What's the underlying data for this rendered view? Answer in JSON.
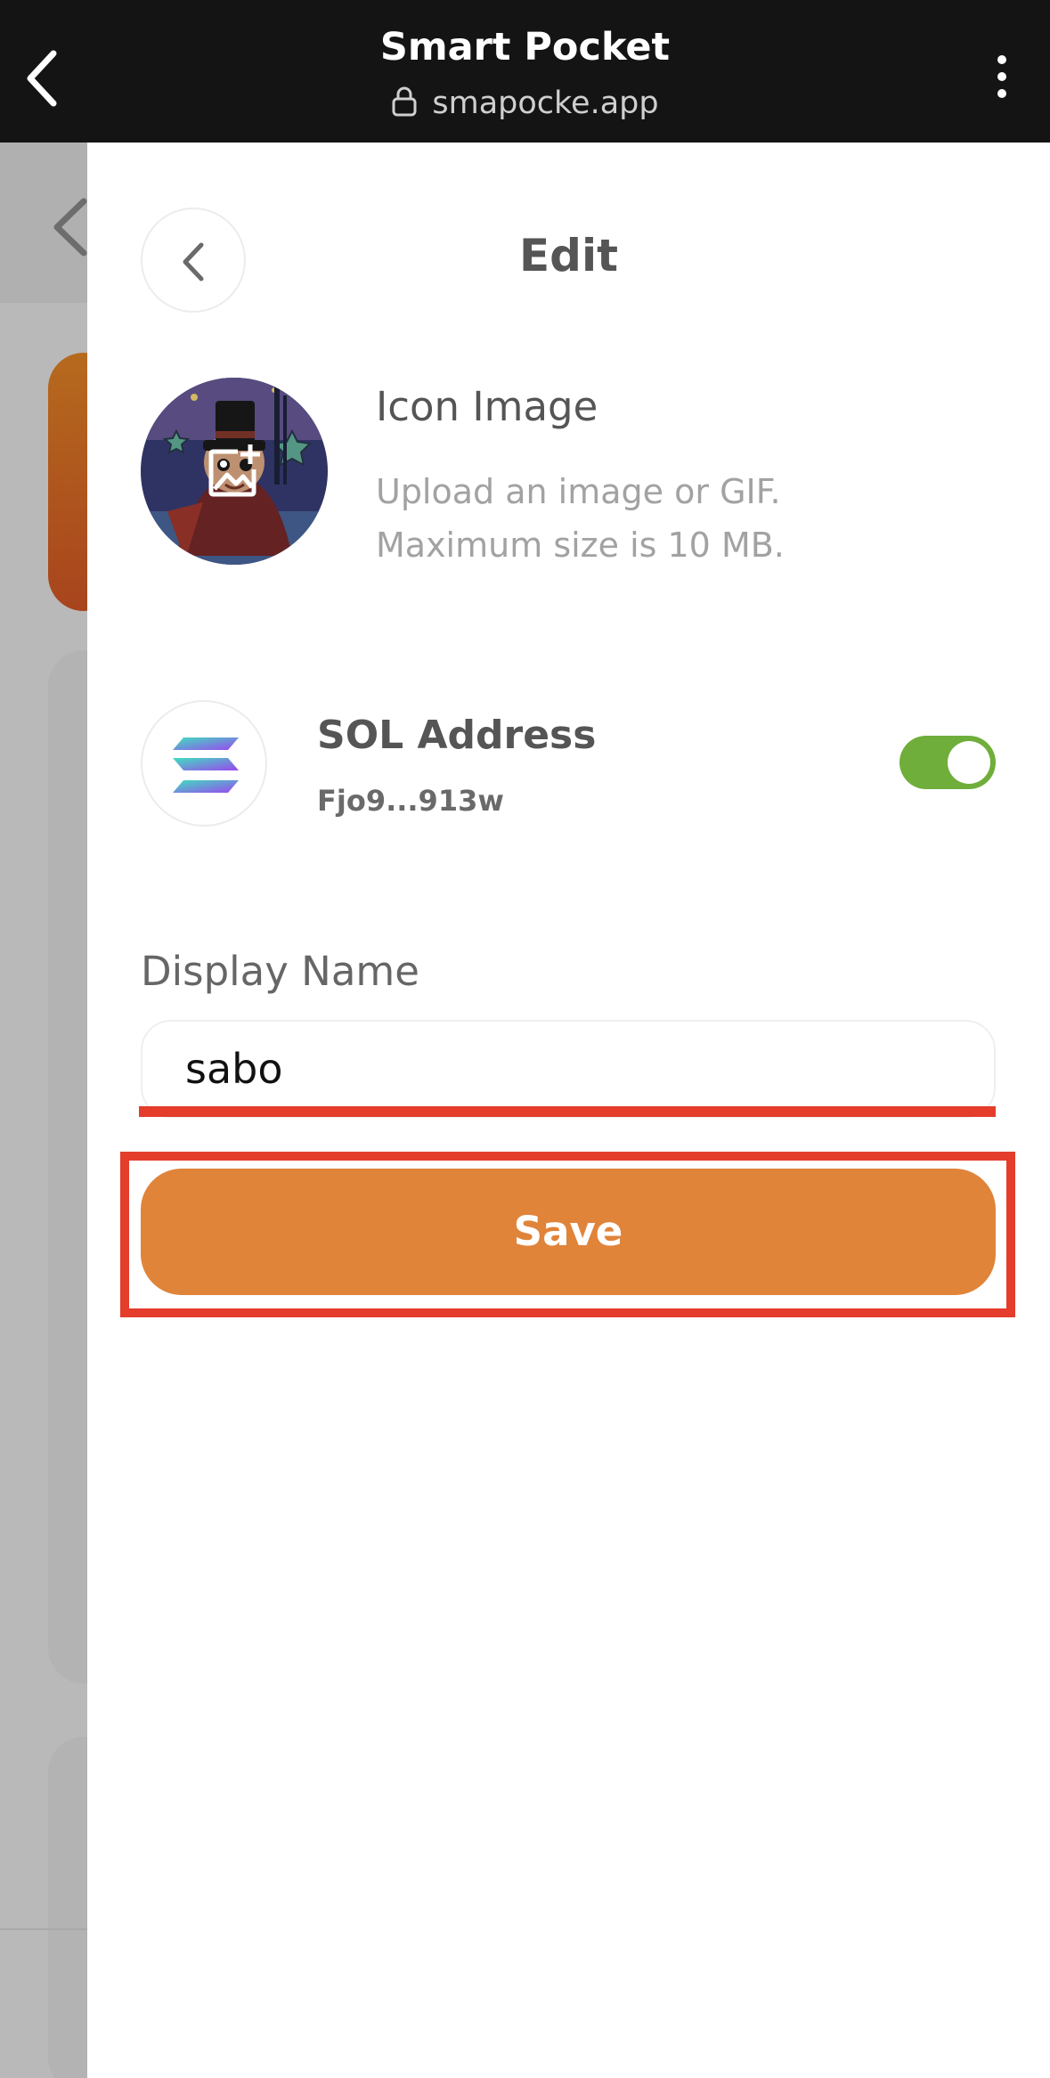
{
  "browser": {
    "title": "Smart Pocket",
    "url": "smapocke.app",
    "back_icon": "chevron-left-icon",
    "menu_icon": "more-vertical-icon",
    "lock_icon": "lock-icon"
  },
  "panel": {
    "title": "Edit",
    "back_icon": "chevron-left-icon"
  },
  "icon_image": {
    "title": "Icon Image",
    "description_line1": "Upload an image or GIF.",
    "description_line2": "Maximum size is 10 MB.",
    "overlay_icon": "image-add-icon"
  },
  "sol": {
    "title": "SOL Address",
    "address": "Fjo9...913w",
    "toggle_on": true,
    "logo_icon": "solana-icon"
  },
  "display_name": {
    "label": "Display Name",
    "value": "sabo"
  },
  "save": {
    "label": "Save"
  },
  "colors": {
    "accent_orange": "#e0843a",
    "toggle_green": "#6fae3b",
    "highlight_red": "#e43d2c",
    "topbar": "#141414"
  }
}
